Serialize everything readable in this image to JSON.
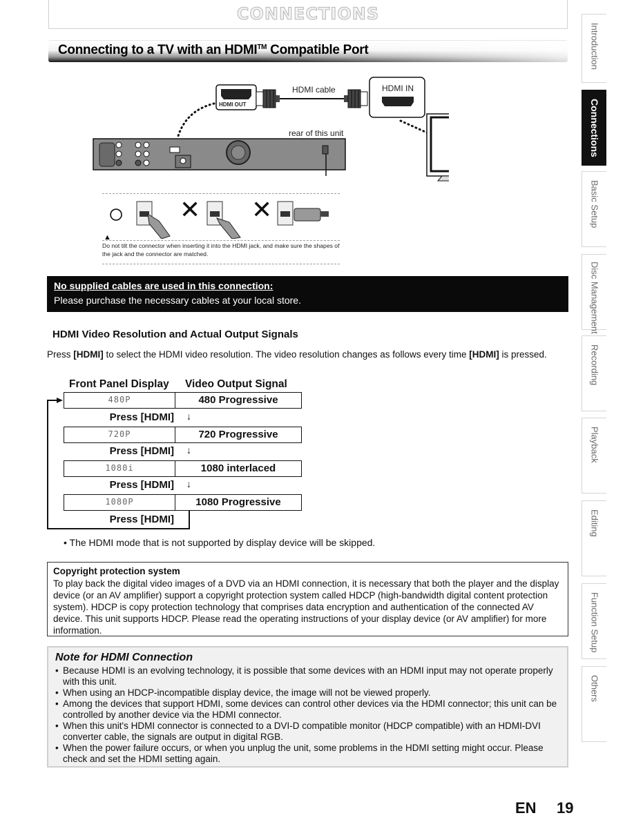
{
  "header": {
    "chapter_title": "CONNECTIONS",
    "section_title": "Connecting to a TV with an HDMI",
    "section_title_sup": "TM",
    "section_title_rest": " Compatible Port"
  },
  "side_tabs": [
    {
      "label": "Introduction",
      "active": false
    },
    {
      "label": "Connections",
      "active": true
    },
    {
      "label": "Basic Setup",
      "active": false
    },
    {
      "label": "Disc Management",
      "active": false
    },
    {
      "label": "Recording",
      "active": false
    },
    {
      "label": "Playback",
      "active": false
    },
    {
      "label": "Editing",
      "active": false
    },
    {
      "label": "Function Setup",
      "active": false
    },
    {
      "label": "Others",
      "active": false
    }
  ],
  "diagram": {
    "hdmi_out_label": "HDMI OUT",
    "cable_label": "HDMI cable",
    "hdmi_in_label": "HDMI IN",
    "rear_label": "rear of this unit",
    "correct_symbol": "○",
    "wrong_symbol": "✕",
    "caution_text": "Do not tilt the connector when inserting it into the HDMI jack, and make sure the shapes of the jack and the connector are matched."
  },
  "notice": {
    "title": "No supplied cables are used in this connection:",
    "body": "Please purchase the necessary cables at your local store."
  },
  "resolution": {
    "heading": "HDMI Video Resolution and Actual Output Signals",
    "intro_pre": "Press ",
    "intro_key": "[HDMI]",
    "intro_mid": " to select the HDMI video resolution. The video resolution changes as follows every time ",
    "intro_key2": "[HDMI]",
    "intro_post": " is pressed.",
    "col_display": "Front Panel Display",
    "col_signal": "Video Output Signal",
    "press_label": "Press [HDMI]",
    "arrow": "↓",
    "rows": [
      {
        "display": "480P",
        "signal": "480 Progressive"
      },
      {
        "display": "720P",
        "signal": "720 Progressive"
      },
      {
        "display": "1080i",
        "signal": "1080 interlaced"
      },
      {
        "display": "1080P",
        "signal": "1080 Progressive"
      }
    ],
    "skip_note": "• The HDMI mode that is not supported by display device will be skipped."
  },
  "copyright": {
    "title": "Copyright protection system",
    "body": "To play back the digital video images of a DVD via an HDMI connection, it is necessary that both the player and the display device (or an AV amplifier) support a copyright protection system called HDCP (high-bandwidth digital content protection system). HDCP is copy protection technology that comprises data encryption and authentication of the connected AV device. This unit supports HDCP. Please read the operating instructions of your display device (or AV amplifier) for more information."
  },
  "note": {
    "title": "Note for HDMI Connection",
    "items": [
      "Because HDMI is an evolving technology, it is possible that some devices with an HDMI input may not operate properly with this unit.",
      "When using an HDCP-incompatible display device, the image will not be viewed properly.",
      "Among the devices that support HDMI, some devices can control other devices via the HDMI connector; this unit can be controlled by another device via the HDMI connector.",
      "When this unit's HDMI connector is connected to a DVI-D compatible monitor (HDCP compatible) with an HDMI-DVI converter cable, the signals are output in digital RGB.",
      "When the power failure occurs, or when you unplug the unit, some problems in the HDMI setting might occur. Please check and set the HDMI setting again."
    ]
  },
  "footer": {
    "language": "EN",
    "page_number": "19"
  }
}
